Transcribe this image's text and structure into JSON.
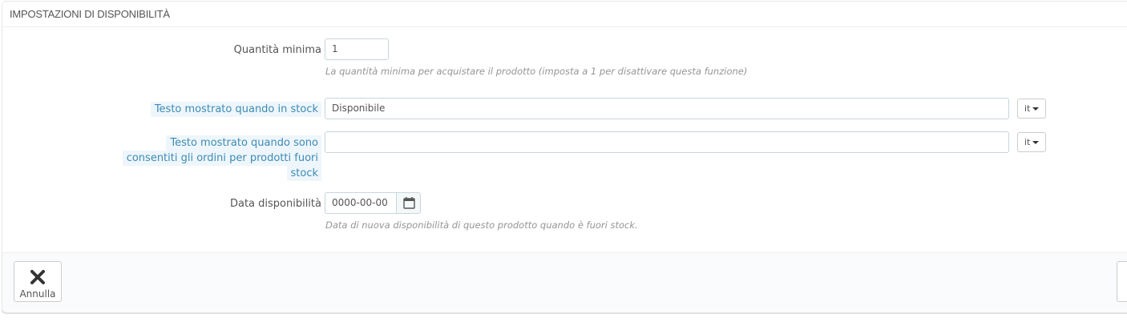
{
  "panel": {
    "title": "IMPOSTAZIONI DI DISPONIBILITÀ"
  },
  "fields": {
    "min_qty": {
      "label": "Quantità minima",
      "value": "1",
      "help": "La quantità minima per acquistare il prodotto (imposta a 1 per disattivare questa funzione)"
    },
    "in_stock_text": {
      "label": "Testo mostrato quando in stock",
      "value": "Disponibile",
      "lang": "it"
    },
    "oos_text": {
      "label_line1": "Testo mostrato quando sono",
      "label_line2": "consentiti gli ordini per prodotti fuori",
      "label_line3": "stock",
      "value": "",
      "lang": "it"
    },
    "available_date": {
      "label": "Data disponibilità",
      "value": "0000-00-00",
      "help": "Data di nuova disponibilità di questo prodotto quando è fuori stock."
    }
  },
  "footer": {
    "cancel_label": "Annulla"
  },
  "icons": {
    "cancel": "close-icon",
    "calendar": "calendar-icon",
    "lang_dropdown": "chevron-down-icon"
  },
  "colors": {
    "hint_label": "#3c8bb5",
    "hint_bg": "#eef6fb",
    "help_text": "#959595"
  }
}
